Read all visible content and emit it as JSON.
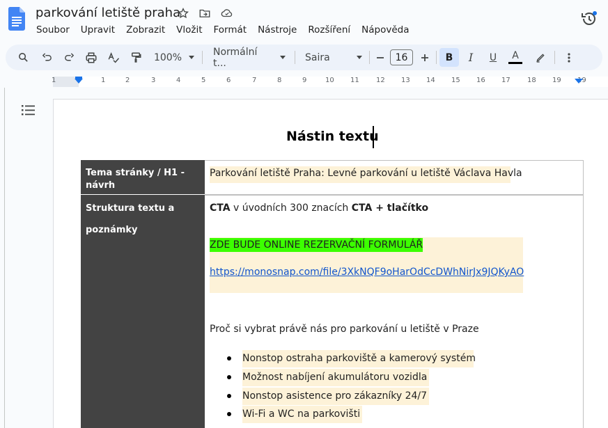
{
  "app": {
    "doc_title": "parkování letiště praha",
    "menu": [
      "Soubor",
      "Upravit",
      "Zobrazit",
      "Vložit",
      "Formát",
      "Nástroje",
      "Rozšíření",
      "Nápověda"
    ]
  },
  "toolbar": {
    "zoom": "100%",
    "style": "Normální t...",
    "font": "Saira",
    "font_size": "16",
    "bold": "B",
    "italic": "I",
    "underline": "U",
    "text_color": "A",
    "text_color_value": "#000000"
  },
  "ruler": {
    "numbers": [
      "1",
      "1",
      "2",
      "3",
      "4",
      "5",
      "6",
      "7",
      "8",
      "9",
      "10",
      "11",
      "12",
      "13",
      "14",
      "15",
      "16",
      "17",
      "18",
      "19"
    ]
  },
  "document": {
    "heading": "Nástin textu",
    "rows": [
      {
        "label": "Tema stránky / H1 - návrh",
        "content": "Parkování letiště Praha: Levné parkování u letiště Václava Havla"
      },
      {
        "label_line1": "Struktura textu a",
        "label_line2": "poznámky",
        "cta_bold1": "CTA",
        "cta_normal": " v úvodních 300 znacích ",
        "cta_bold2": "CTA + tlačítko",
        "form_note": "ZDE BUDE ONLINE REZERVAČNÍ FORMULÁŘ",
        "link": "https://monosnap.com/file/3XkNQF9oHarOdCcDWhNirJx9JQKyAO",
        "question": "Proč si vybrat právě nás pro parkování u letiště v Praze",
        "bullets": [
          "Nonstop ostraha parkoviště a kamerový systém",
          "Možnost nabíjení akumulátoru vozidla",
          "Nonstop asistence pro zákazníky 24/7",
          "Wi-Fi a WC na parkovišti"
        ]
      }
    ]
  },
  "colors": {
    "accent": "#1a73e8",
    "highlight": "#fdf2d8",
    "green_highlight": "#3cff00",
    "label_cell": "#434343",
    "link": "#1155cc"
  }
}
